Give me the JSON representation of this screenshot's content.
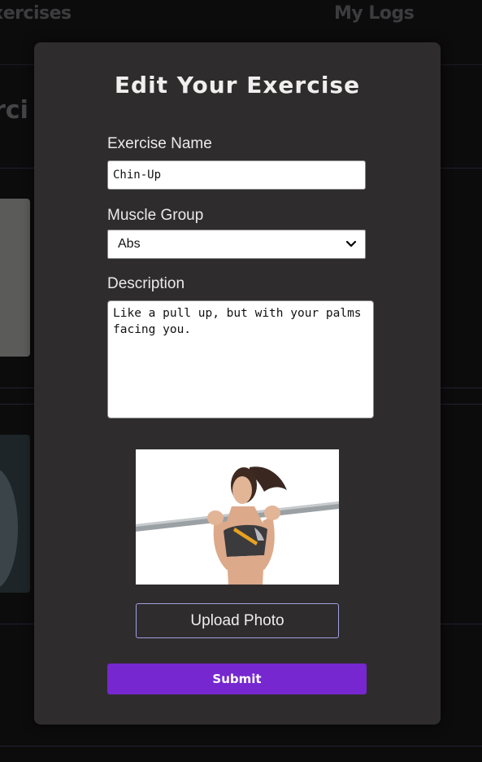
{
  "background": {
    "nav": {
      "left_link": "xercises",
      "right_link": "My Logs"
    },
    "heading_partial": "rci"
  },
  "modal": {
    "title": "Edit Your Exercise",
    "exercise_name": {
      "label": "Exercise Name",
      "value": "Chin-Up"
    },
    "muscle_group": {
      "label": "Muscle Group",
      "selected": "Abs"
    },
    "description": {
      "label": "Description",
      "value": "Like a pull up, but with your palms facing you."
    },
    "photo_icon": "exercise-photo-chin-up",
    "upload_label": "Upload Photo",
    "submit_label": "Submit"
  },
  "colors": {
    "page_bg": "#141314",
    "modal_bg": "#2f2c2d",
    "accent": "#7627cf",
    "upload_border": "#9ea0e0"
  }
}
